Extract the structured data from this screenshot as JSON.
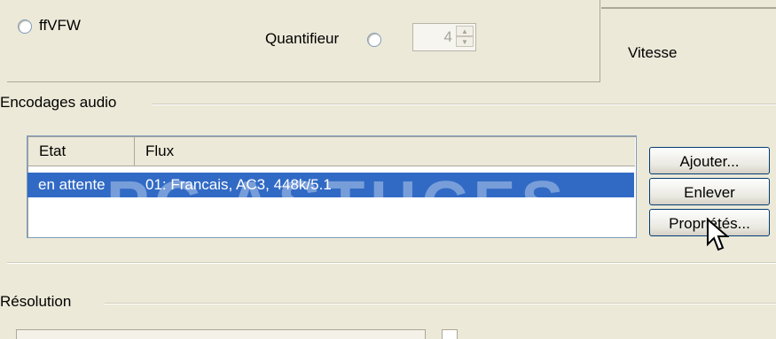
{
  "codec": {
    "ffvfw_label": "ffVFW",
    "quantifier_label": "Quantifieur",
    "quantifier_value": "4"
  },
  "speed": {
    "label": "Vitesse"
  },
  "audio": {
    "group_label": "Encodages audio",
    "columns": [
      "Etat",
      "Flux"
    ],
    "rows": [
      {
        "state": "en attente",
        "stream": "01: Francais, AC3, 448k/5.1"
      }
    ],
    "buttons": {
      "add": "Ajouter...",
      "remove": "Enlever",
      "properties": "Propriétés..."
    }
  },
  "resolution": {
    "group_label": "Résolution"
  },
  "watermark": "PC ASTUCES",
  "colors": {
    "selection": "#316ac5",
    "window_bg": "#ece9d8"
  }
}
